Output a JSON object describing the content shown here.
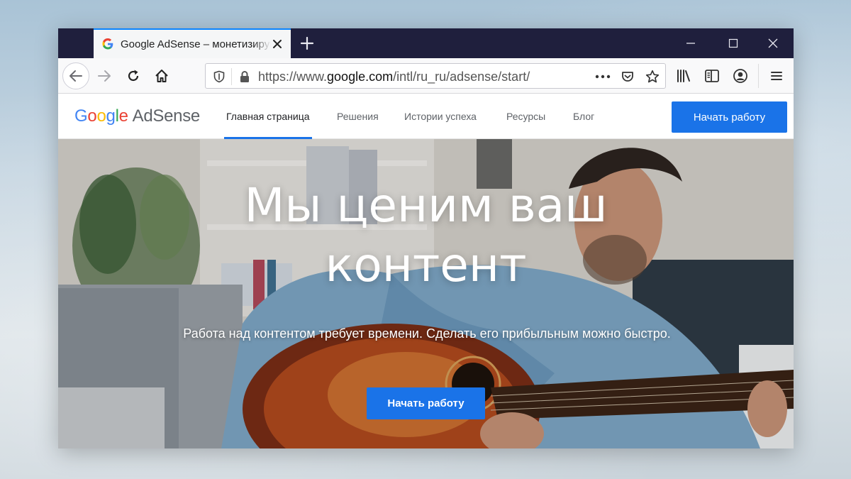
{
  "browser": {
    "tab_title": "Google AdSense – монетизируйте свой сайт",
    "url_prefix": "https://www.",
    "url_domain": "google.com",
    "url_path": "/intl/ru_ru/adsense/start/"
  },
  "site": {
    "logo_google": [
      "G",
      "o",
      "o",
      "g",
      "l",
      "e"
    ],
    "logo_product": "AdSense",
    "menu": [
      {
        "label": "Главная страница",
        "active": true
      },
      {
        "label": "Решения",
        "active": false
      },
      {
        "label": "Истории успеха",
        "active": false
      },
      {
        "label": "Ресурсы",
        "active": false
      },
      {
        "label": "Блог",
        "active": false
      }
    ],
    "cta_label": "Начать работу"
  },
  "hero": {
    "title_line1": "Мы ценим ваш",
    "title_line2": "контент",
    "subtitle": "Работа над контентом требует времени. Сделать его прибыльным можно быстро.",
    "cta_label": "Начать работу"
  },
  "colors": {
    "accent": "#1a73e8",
    "tabbar": "#1f1f3d",
    "firefox_blue": "#0a84ff"
  },
  "icons": [
    "google-favicon-icon",
    "close-icon",
    "plus-icon",
    "minimize-icon",
    "maximize-icon",
    "window-close-icon",
    "back-arrow-icon",
    "forward-arrow-icon",
    "reload-icon",
    "home-icon",
    "shield-icon",
    "lock-icon",
    "more-dots-icon",
    "pocket-icon",
    "star-icon",
    "library-icon",
    "sidebar-icon",
    "account-icon",
    "hamburger-menu-icon"
  ]
}
